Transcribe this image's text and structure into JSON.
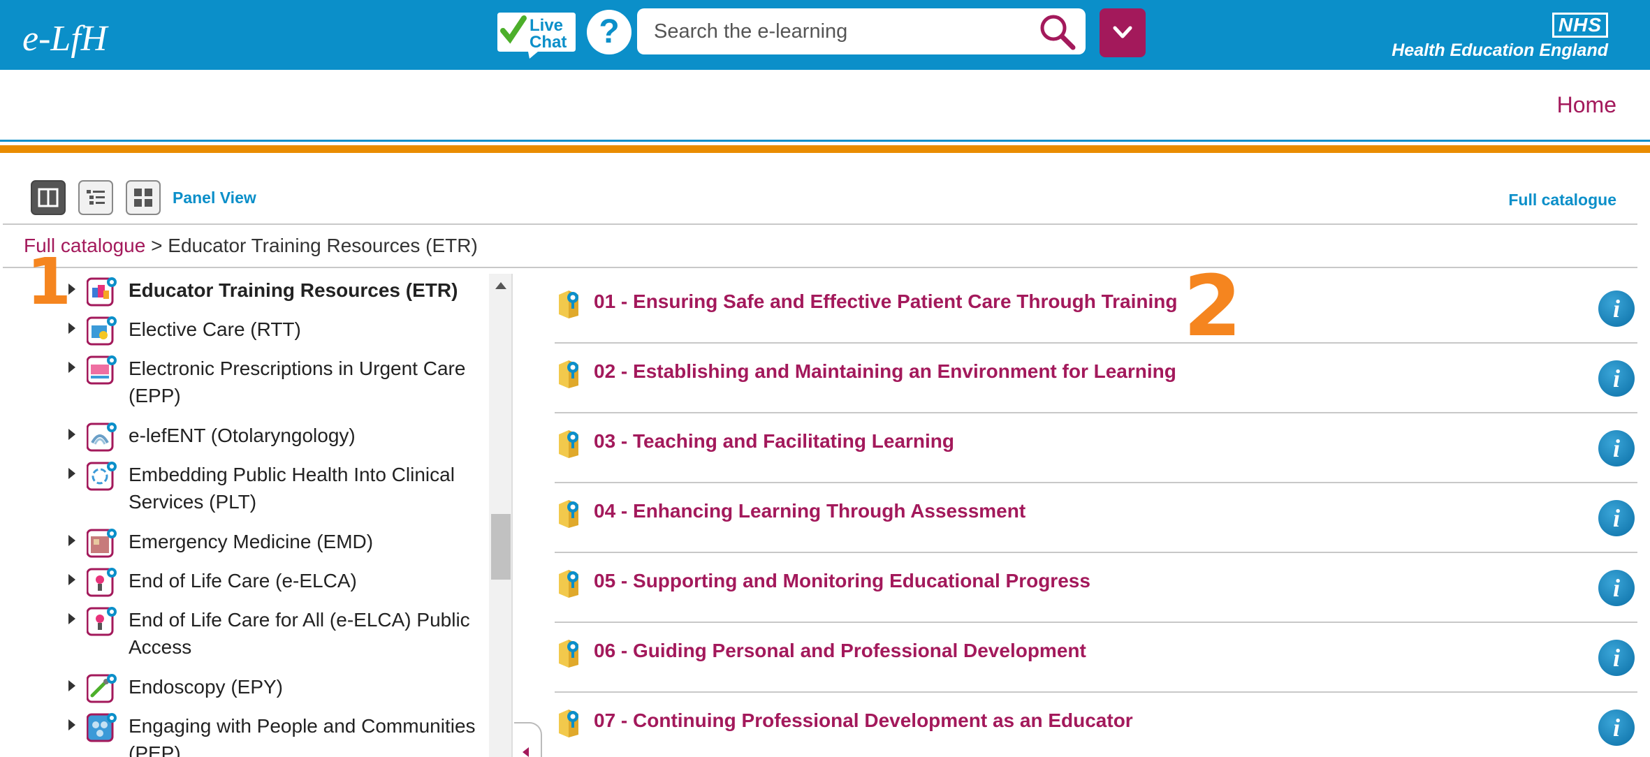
{
  "header": {
    "logo_text": "e-LfH",
    "live_chat": {
      "line1": "Live",
      "line2": "Chat"
    },
    "help_symbol": "?",
    "search": {
      "placeholder": "Search the e-learning",
      "value": ""
    },
    "nhs_logo": "NHS",
    "org_name": "Health Education England",
    "brand_color": "#0b8fc9",
    "accent_color": "#a3195b",
    "rule_color": "#e98c00"
  },
  "nav": {
    "home": "Home"
  },
  "toolbar": {
    "views": [
      {
        "name": "panel-view",
        "icon": "panel-view-icon",
        "active": true
      },
      {
        "name": "list-view",
        "icon": "list-view-icon",
        "active": false
      },
      {
        "name": "grid-view",
        "icon": "grid-view-icon",
        "active": false
      }
    ],
    "current_view_label": "Panel View",
    "full_catalogue_link": "Full catalogue"
  },
  "breadcrumb": {
    "root": "Full catalogue",
    "separator": " > ",
    "current": "Educator Training Resources (ETR)"
  },
  "markers": {
    "left": "1",
    "right": "2"
  },
  "tree": {
    "items": [
      {
        "label": "Educator Training Resources (ETR)",
        "selected": true
      },
      {
        "label": "Elective Care (RTT)",
        "selected": false
      },
      {
        "label": "Electronic Prescriptions in Urgent Care (EPP)",
        "selected": false
      },
      {
        "label": "e-lefENT (Otolaryngology)",
        "selected": false
      },
      {
        "label": "Embedding Public Health Into Clinical Services (PLT)",
        "selected": false
      },
      {
        "label": "Emergency Medicine (EMD)",
        "selected": false
      },
      {
        "label": "End of Life Care (e-ELCA)",
        "selected": false
      },
      {
        "label": "End of Life Care for All (e-ELCA) Public Access",
        "selected": false
      },
      {
        "label": "Endoscopy (EPY)",
        "selected": false
      },
      {
        "label": "Engaging with People and Communities (PEP)",
        "selected": false
      }
    ]
  },
  "courses": {
    "items": [
      {
        "title": "01 - Ensuring Safe and Effective Patient Care Through Training"
      },
      {
        "title": "02 - Establishing and Maintaining an Environment for Learning"
      },
      {
        "title": "03 - Teaching and Facilitating Learning"
      },
      {
        "title": "04 - Enhancing Learning Through Assessment"
      },
      {
        "title": "05 - Supporting and Monitoring Educational Progress"
      },
      {
        "title": "06 - Guiding Personal and Professional Development"
      },
      {
        "title": "07 - Continuing Professional Development as an Educator"
      }
    ],
    "info_symbol": "i"
  }
}
